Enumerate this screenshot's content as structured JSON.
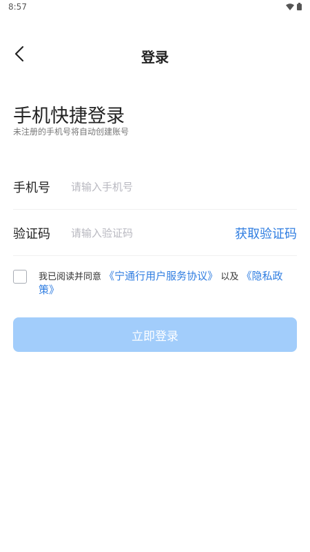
{
  "status_bar": {
    "time": "8:57",
    "wifi_icon": "wifi-icon",
    "battery_icon": "battery-icon"
  },
  "nav": {
    "back_icon": "chevron-left-icon",
    "title": "登录"
  },
  "heading": "手机快捷登录",
  "subheading": "未注册的手机号将自动创建账号",
  "phone": {
    "label": "手机号",
    "placeholder": "请输入手机号",
    "value": ""
  },
  "code": {
    "label": "验证码",
    "placeholder": "请输入验证码",
    "value": "",
    "get_code_label": "获取验证码"
  },
  "agreement": {
    "checked": false,
    "prefix": "我已阅读并同意",
    "user_agreement_link": "《宁通行用户服务协议》",
    "conjunction": "以及",
    "privacy_link": "《隐私政策》"
  },
  "login_button": "立即登录",
  "colors": {
    "accent": "#2f7de1",
    "button_disabled": "#a2cdfb"
  }
}
